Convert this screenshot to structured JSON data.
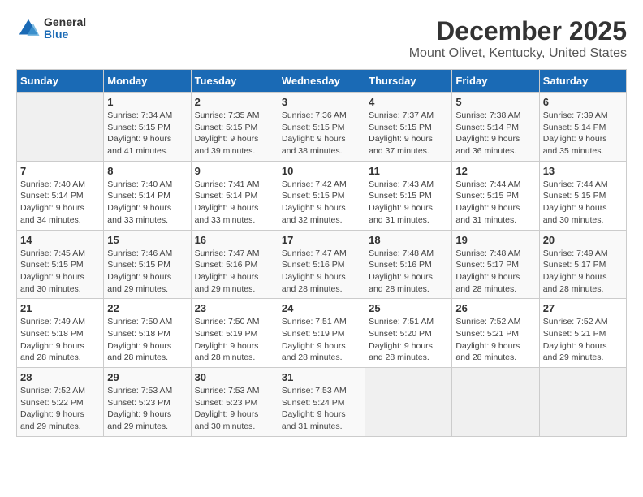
{
  "logo": {
    "general": "General",
    "blue": "Blue"
  },
  "title": "December 2025",
  "location": "Mount Olivet, Kentucky, United States",
  "headers": [
    "Sunday",
    "Monday",
    "Tuesday",
    "Wednesday",
    "Thursday",
    "Friday",
    "Saturday"
  ],
  "weeks": [
    [
      {
        "day": "",
        "info": ""
      },
      {
        "day": "1",
        "info": "Sunrise: 7:34 AM\nSunset: 5:15 PM\nDaylight: 9 hours\nand 41 minutes."
      },
      {
        "day": "2",
        "info": "Sunrise: 7:35 AM\nSunset: 5:15 PM\nDaylight: 9 hours\nand 39 minutes."
      },
      {
        "day": "3",
        "info": "Sunrise: 7:36 AM\nSunset: 5:15 PM\nDaylight: 9 hours\nand 38 minutes."
      },
      {
        "day": "4",
        "info": "Sunrise: 7:37 AM\nSunset: 5:15 PM\nDaylight: 9 hours\nand 37 minutes."
      },
      {
        "day": "5",
        "info": "Sunrise: 7:38 AM\nSunset: 5:14 PM\nDaylight: 9 hours\nand 36 minutes."
      },
      {
        "day": "6",
        "info": "Sunrise: 7:39 AM\nSunset: 5:14 PM\nDaylight: 9 hours\nand 35 minutes."
      }
    ],
    [
      {
        "day": "7",
        "info": "Sunrise: 7:40 AM\nSunset: 5:14 PM\nDaylight: 9 hours\nand 34 minutes."
      },
      {
        "day": "8",
        "info": "Sunrise: 7:40 AM\nSunset: 5:14 PM\nDaylight: 9 hours\nand 33 minutes."
      },
      {
        "day": "9",
        "info": "Sunrise: 7:41 AM\nSunset: 5:14 PM\nDaylight: 9 hours\nand 33 minutes."
      },
      {
        "day": "10",
        "info": "Sunrise: 7:42 AM\nSunset: 5:15 PM\nDaylight: 9 hours\nand 32 minutes."
      },
      {
        "day": "11",
        "info": "Sunrise: 7:43 AM\nSunset: 5:15 PM\nDaylight: 9 hours\nand 31 minutes."
      },
      {
        "day": "12",
        "info": "Sunrise: 7:44 AM\nSunset: 5:15 PM\nDaylight: 9 hours\nand 31 minutes."
      },
      {
        "day": "13",
        "info": "Sunrise: 7:44 AM\nSunset: 5:15 PM\nDaylight: 9 hours\nand 30 minutes."
      }
    ],
    [
      {
        "day": "14",
        "info": "Sunrise: 7:45 AM\nSunset: 5:15 PM\nDaylight: 9 hours\nand 30 minutes."
      },
      {
        "day": "15",
        "info": "Sunrise: 7:46 AM\nSunset: 5:15 PM\nDaylight: 9 hours\nand 29 minutes."
      },
      {
        "day": "16",
        "info": "Sunrise: 7:47 AM\nSunset: 5:16 PM\nDaylight: 9 hours\nand 29 minutes."
      },
      {
        "day": "17",
        "info": "Sunrise: 7:47 AM\nSunset: 5:16 PM\nDaylight: 9 hours\nand 28 minutes."
      },
      {
        "day": "18",
        "info": "Sunrise: 7:48 AM\nSunset: 5:16 PM\nDaylight: 9 hours\nand 28 minutes."
      },
      {
        "day": "19",
        "info": "Sunrise: 7:48 AM\nSunset: 5:17 PM\nDaylight: 9 hours\nand 28 minutes."
      },
      {
        "day": "20",
        "info": "Sunrise: 7:49 AM\nSunset: 5:17 PM\nDaylight: 9 hours\nand 28 minutes."
      }
    ],
    [
      {
        "day": "21",
        "info": "Sunrise: 7:49 AM\nSunset: 5:18 PM\nDaylight: 9 hours\nand 28 minutes."
      },
      {
        "day": "22",
        "info": "Sunrise: 7:50 AM\nSunset: 5:18 PM\nDaylight: 9 hours\nand 28 minutes."
      },
      {
        "day": "23",
        "info": "Sunrise: 7:50 AM\nSunset: 5:19 PM\nDaylight: 9 hours\nand 28 minutes."
      },
      {
        "day": "24",
        "info": "Sunrise: 7:51 AM\nSunset: 5:19 PM\nDaylight: 9 hours\nand 28 minutes."
      },
      {
        "day": "25",
        "info": "Sunrise: 7:51 AM\nSunset: 5:20 PM\nDaylight: 9 hours\nand 28 minutes."
      },
      {
        "day": "26",
        "info": "Sunrise: 7:52 AM\nSunset: 5:21 PM\nDaylight: 9 hours\nand 28 minutes."
      },
      {
        "day": "27",
        "info": "Sunrise: 7:52 AM\nSunset: 5:21 PM\nDaylight: 9 hours\nand 29 minutes."
      }
    ],
    [
      {
        "day": "28",
        "info": "Sunrise: 7:52 AM\nSunset: 5:22 PM\nDaylight: 9 hours\nand 29 minutes."
      },
      {
        "day": "29",
        "info": "Sunrise: 7:53 AM\nSunset: 5:23 PM\nDaylight: 9 hours\nand 29 minutes."
      },
      {
        "day": "30",
        "info": "Sunrise: 7:53 AM\nSunset: 5:23 PM\nDaylight: 9 hours\nand 30 minutes."
      },
      {
        "day": "31",
        "info": "Sunrise: 7:53 AM\nSunset: 5:24 PM\nDaylight: 9 hours\nand 31 minutes."
      },
      {
        "day": "",
        "info": ""
      },
      {
        "day": "",
        "info": ""
      },
      {
        "day": "",
        "info": ""
      }
    ]
  ]
}
